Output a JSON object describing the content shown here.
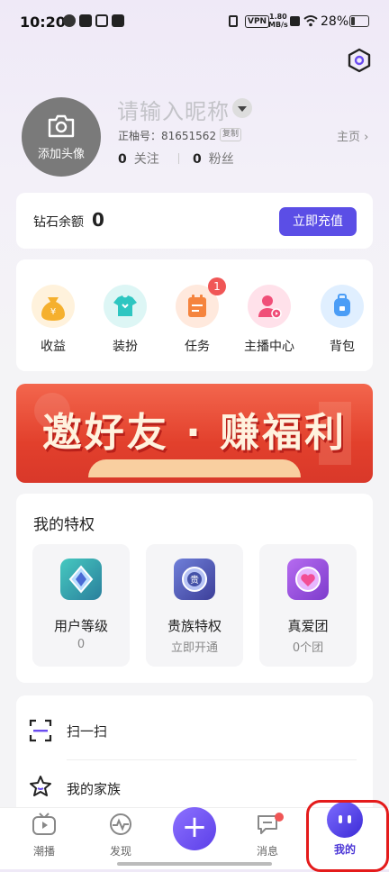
{
  "status_bar": {
    "time": "10:20",
    "vpn": "VPN",
    "speed_value": "1.80",
    "speed_unit": "MB/s",
    "battery": "28%",
    "battery_level": 0.28
  },
  "profile": {
    "avatar_label": "添加头像",
    "nickname_placeholder": "请输入昵称",
    "id_text": "正柚号：81651562",
    "copy_label": "复制",
    "home_link": "主页",
    "following_count": "0",
    "following_label": "关注",
    "fans_count": "0",
    "fans_label": "粉丝"
  },
  "wallet": {
    "label": "钻石余额",
    "value": "0",
    "recharge_button": "立即充值"
  },
  "features": [
    {
      "label": "收益",
      "icon": "money-bag-icon",
      "color": "#f5b02e"
    },
    {
      "label": "装扮",
      "icon": "tshirt-icon",
      "color": "#2ec6c1"
    },
    {
      "label": "任务",
      "icon": "task-calendar-icon",
      "color": "#f5843e",
      "badge": "1"
    },
    {
      "label": "主播中心",
      "icon": "anchor-user-icon",
      "color": "#f04f78"
    },
    {
      "label": "背包",
      "icon": "backpack-icon",
      "color": "#4b9df6"
    }
  ],
  "banner": {
    "text": "邀好友 · 赚福利"
  },
  "privileges": {
    "title": "我的特权",
    "items": [
      {
        "title": "用户等级",
        "subtitle": "0",
        "icon": "level-diamond-icon"
      },
      {
        "title": "贵族特权",
        "subtitle": "立即开通",
        "icon": "noble-badge-icon"
      },
      {
        "title": "真爱团",
        "subtitle": "0个团",
        "icon": "heart-badge-icon"
      }
    ]
  },
  "menu_rows": [
    {
      "label": "扫一扫",
      "icon": "scan-icon"
    },
    {
      "label": "我的家族",
      "icon": "family-star-icon"
    }
  ],
  "tabbar": {
    "tabs": [
      {
        "label": "潮播",
        "icon": "tv-play-icon"
      },
      {
        "label": "发现",
        "icon": "discover-pulse-icon"
      },
      {
        "label": "消息",
        "icon": "message-bubble-icon"
      },
      {
        "label": "我的",
        "icon": "me-face-icon",
        "active": true
      }
    ]
  }
}
